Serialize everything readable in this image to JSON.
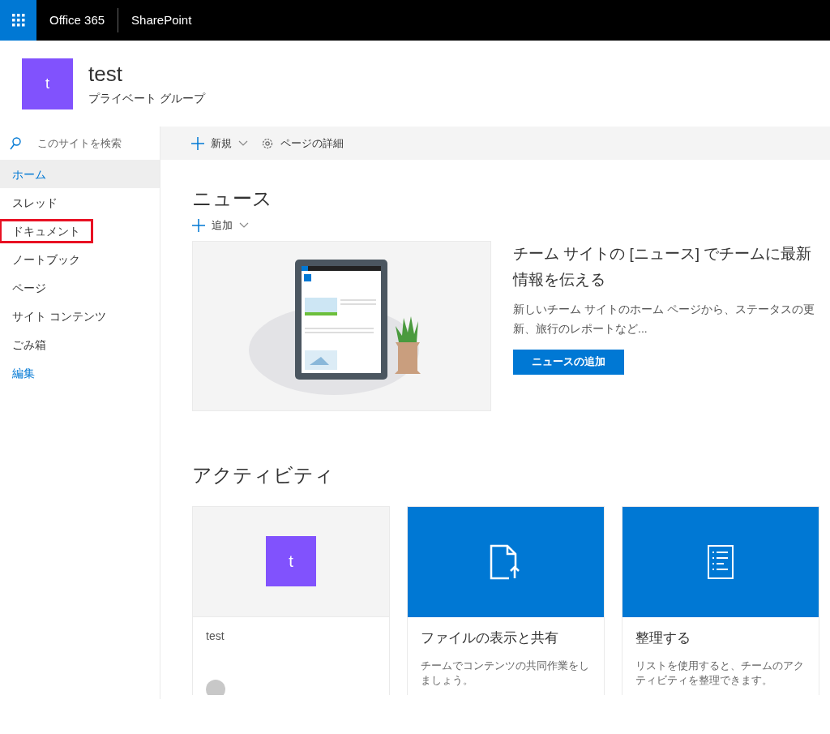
{
  "top_bar": {
    "brand": "Office 365",
    "product": "SharePoint"
  },
  "site_header": {
    "logo_letter": "t",
    "title": "test",
    "subtitle": "プライベート グループ"
  },
  "sidebar": {
    "search": {
      "placeholder": "このサイトを検索"
    },
    "items": [
      {
        "label": "ホーム",
        "kind": "link",
        "selected": true,
        "highlighted": false
      },
      {
        "label": "スレッド",
        "kind": "link",
        "selected": false,
        "highlighted": false
      },
      {
        "label": "ドキュメント",
        "kind": "link",
        "selected": false,
        "highlighted": true
      },
      {
        "label": "ノートブック",
        "kind": "link",
        "selected": false,
        "highlighted": false
      },
      {
        "label": "ページ",
        "kind": "link",
        "selected": false,
        "highlighted": false
      },
      {
        "label": "サイト コンテンツ",
        "kind": "link",
        "selected": false,
        "highlighted": false
      },
      {
        "label": "ごみ箱",
        "kind": "link",
        "selected": false,
        "highlighted": false
      },
      {
        "label": "編集",
        "kind": "edit",
        "selected": false,
        "highlighted": false
      }
    ]
  },
  "command_bar": [
    {
      "label": "新規",
      "kind": "new"
    },
    {
      "label": "ページの詳細",
      "kind": "details"
    }
  ],
  "news": {
    "title": "ニュース",
    "add": "追加",
    "headline": "チーム サイトの [ニュース] でチームに最新情報を伝える",
    "description": "新しいチーム サイトのホーム ページから、ステータスの更新、旅行のレポートなど...",
    "button": "ニュースの追加"
  },
  "activity": {
    "title": "アクティビティ",
    "cards": [
      {
        "kind": "site",
        "letter": "t",
        "title": "test"
      },
      {
        "kind": "file",
        "title": "ファイルの表示と共有",
        "description": "チームでコンテンツの共同作業をしましょう。"
      },
      {
        "kind": "list",
        "title": "整理する",
        "description": "リストを使用すると、チームのアクティビティを整理できます。"
      }
    ]
  }
}
